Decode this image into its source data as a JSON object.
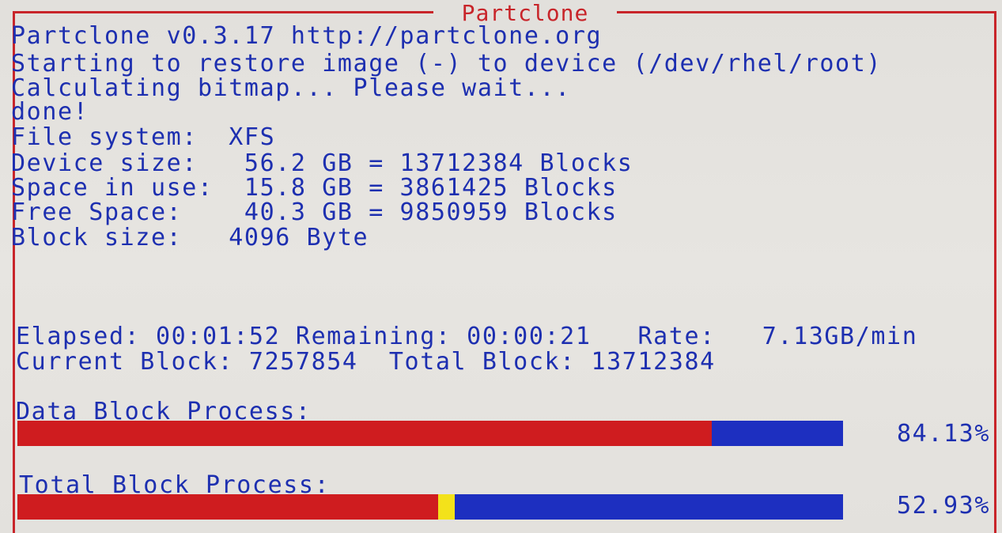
{
  "window": {
    "title": "Partclone",
    "frame_color": "#c8252a",
    "text_color": "#1d2fb0"
  },
  "log": {
    "version_line": "Partclone v0.3.17 http://partclone.org",
    "starting_line": "Starting to restore image (-) to device (/dev/rhel/root)",
    "calculating_line": "Calculating bitmap... Please wait...",
    "done_line": "done!",
    "file_system_line": "File system:  XFS",
    "device_size_line": "Device size:   56.2 GB = 13712384 Blocks",
    "space_in_use_line": "Space in use:  15.8 GB = 3861425 Blocks",
    "free_space_line": "Free Space:    40.3 GB = 9850959 Blocks",
    "block_size_line": "Block size:   4096 Byte"
  },
  "status": {
    "elapsed_line": "Elapsed: 00:01:52 Remaining: 00:00:21   Rate:   7.13GB/min",
    "current_block_line": "Current Block: 7257854  Total Block: 13712384"
  },
  "progress": {
    "data_block": {
      "label": "Data Block Process:",
      "percent_text": "84.13%",
      "fraction": 0.8413,
      "fill_color": "#cf1c1f",
      "track_color": "#1d2fc0"
    },
    "total_block": {
      "label": "Total Block Process:",
      "percent_text": "52.93%",
      "fraction": 0.5293,
      "fill_color": "#cf1c1f",
      "track_color": "#1d2fc0",
      "cursor_color": "#f3e21a"
    }
  }
}
